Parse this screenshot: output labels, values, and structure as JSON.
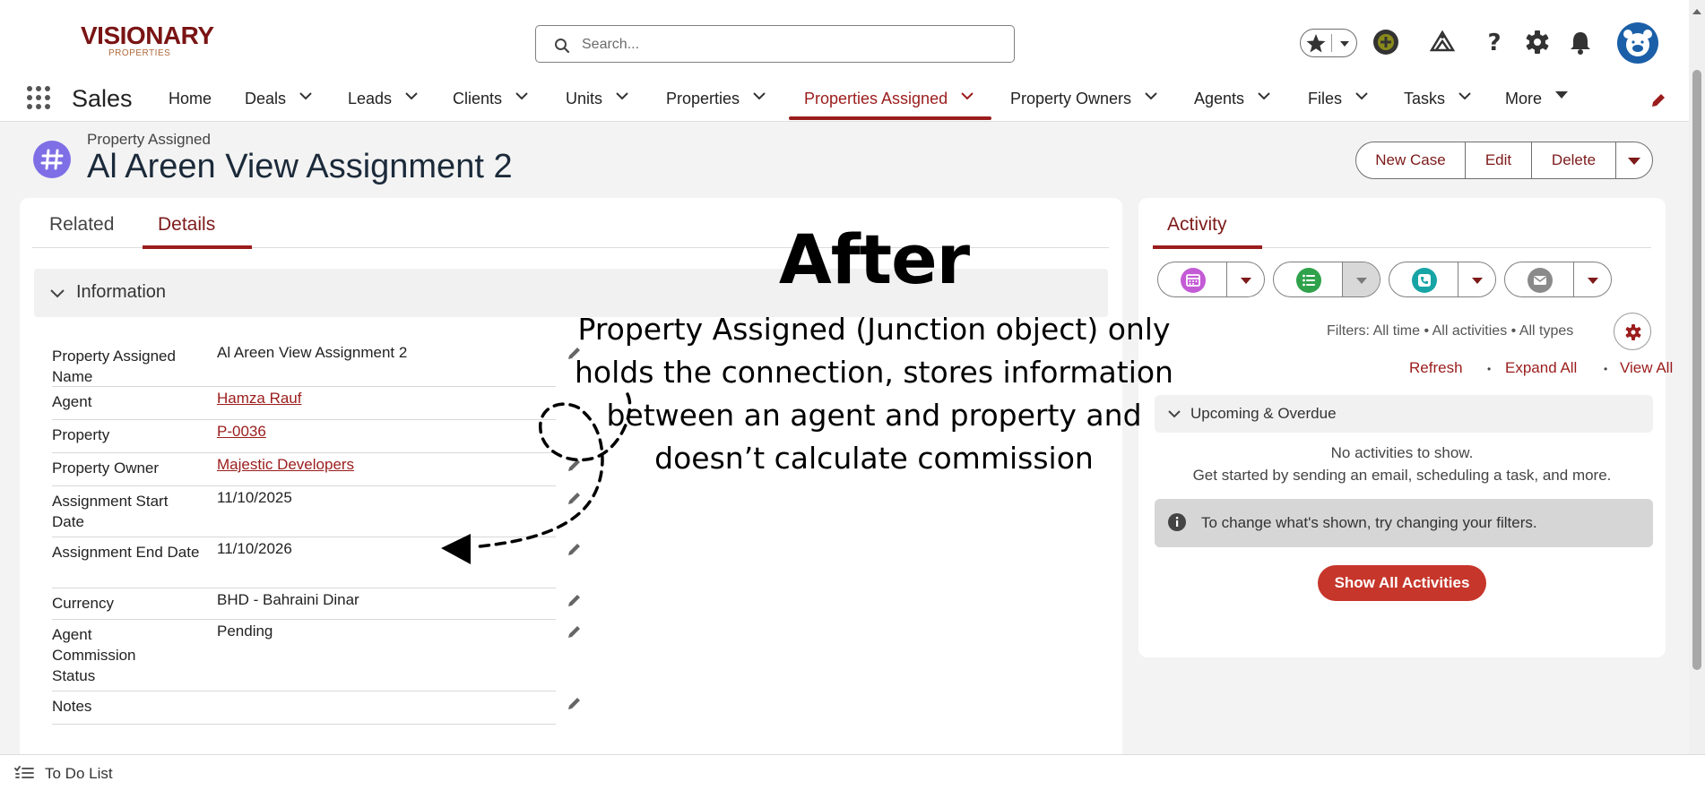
{
  "brand": {
    "logo_text": "VISIONARY",
    "logo_subtext": "PROPERTIES"
  },
  "search": {
    "placeholder": "Search..."
  },
  "nav": {
    "app_name": "Sales",
    "items": [
      {
        "label": "Home"
      },
      {
        "label": "Deals"
      },
      {
        "label": "Leads"
      },
      {
        "label": "Clients"
      },
      {
        "label": "Units"
      },
      {
        "label": "Properties"
      },
      {
        "label": "Properties Assigned"
      },
      {
        "label": "Property Owners"
      },
      {
        "label": "Agents"
      },
      {
        "label": "Files"
      },
      {
        "label": "Tasks"
      },
      {
        "label": "More"
      }
    ],
    "active": "Properties Assigned"
  },
  "record": {
    "type": "Property Assigned",
    "title": "Al Areen View Assignment 2",
    "actions": [
      "New Case",
      "Edit",
      "Delete"
    ]
  },
  "tabs": [
    "Related",
    "Details"
  ],
  "active_tab": "Details",
  "section": {
    "title": "Information"
  },
  "fields": [
    {
      "label": "Property Assigned Name",
      "value": "Al Areen View Assignment 2"
    },
    {
      "label": "Agent",
      "value": "Hamza Rauf"
    },
    {
      "label": "Property",
      "value": "P-0036"
    },
    {
      "label": "Property Owner",
      "value": "Majestic Developers"
    },
    {
      "label": "Assignment Start Date",
      "value": "11/10/2025"
    },
    {
      "label": "Assignment End Date",
      "value": "11/10/2026"
    },
    {
      "label": "Currency",
      "value": "BHD - Bahraini Dinar"
    },
    {
      "label": "Agent Commission Status",
      "value": "Pending"
    },
    {
      "label": "Notes",
      "value": ""
    }
  ],
  "activity": {
    "tab": "Activity",
    "filters": "Filters: All time • All activities • All types",
    "links": [
      "Refresh",
      "Expand All",
      "View All"
    ],
    "upcoming": "Upcoming & Overdue",
    "empty_title": "No activities to show.",
    "empty_sub": "Get started by sending an email, scheduling a task, and more.",
    "info": "To change what's shown, try changing your filters.",
    "show_all": "Show All Activities"
  },
  "annotation": {
    "heading": "After",
    "text": "Property Assigned (Junction object) only holds the connection, stores information between an agent and property and doesn’t calculate commission"
  },
  "utility": {
    "todo": "To Do List"
  },
  "colors": {
    "brand": "#7a1414",
    "accent": "#9b1c1c",
    "button": "#c6362b",
    "record_icon": "#7e6fe6",
    "avatar": "#1b5fa8"
  }
}
